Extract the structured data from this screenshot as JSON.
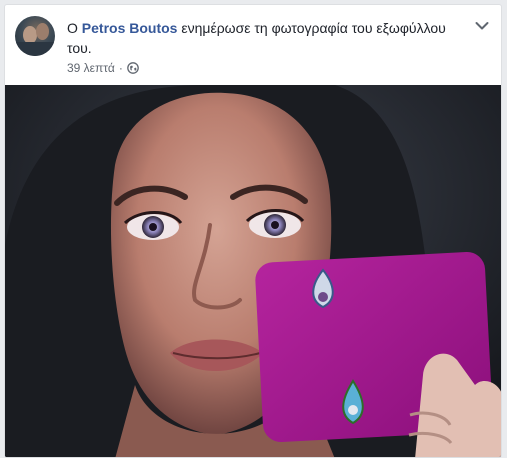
{
  "post": {
    "prefix": "Ο",
    "author": "Petros Boutos",
    "action": "ενημέρωσε τη φωτογραφία του εξωφύλλου του.",
    "time": "39 λεπτά",
    "separator": "·",
    "privacy_icon": "globe-icon",
    "menu_icon": "chevron-down-icon",
    "link_color": "#365899"
  }
}
